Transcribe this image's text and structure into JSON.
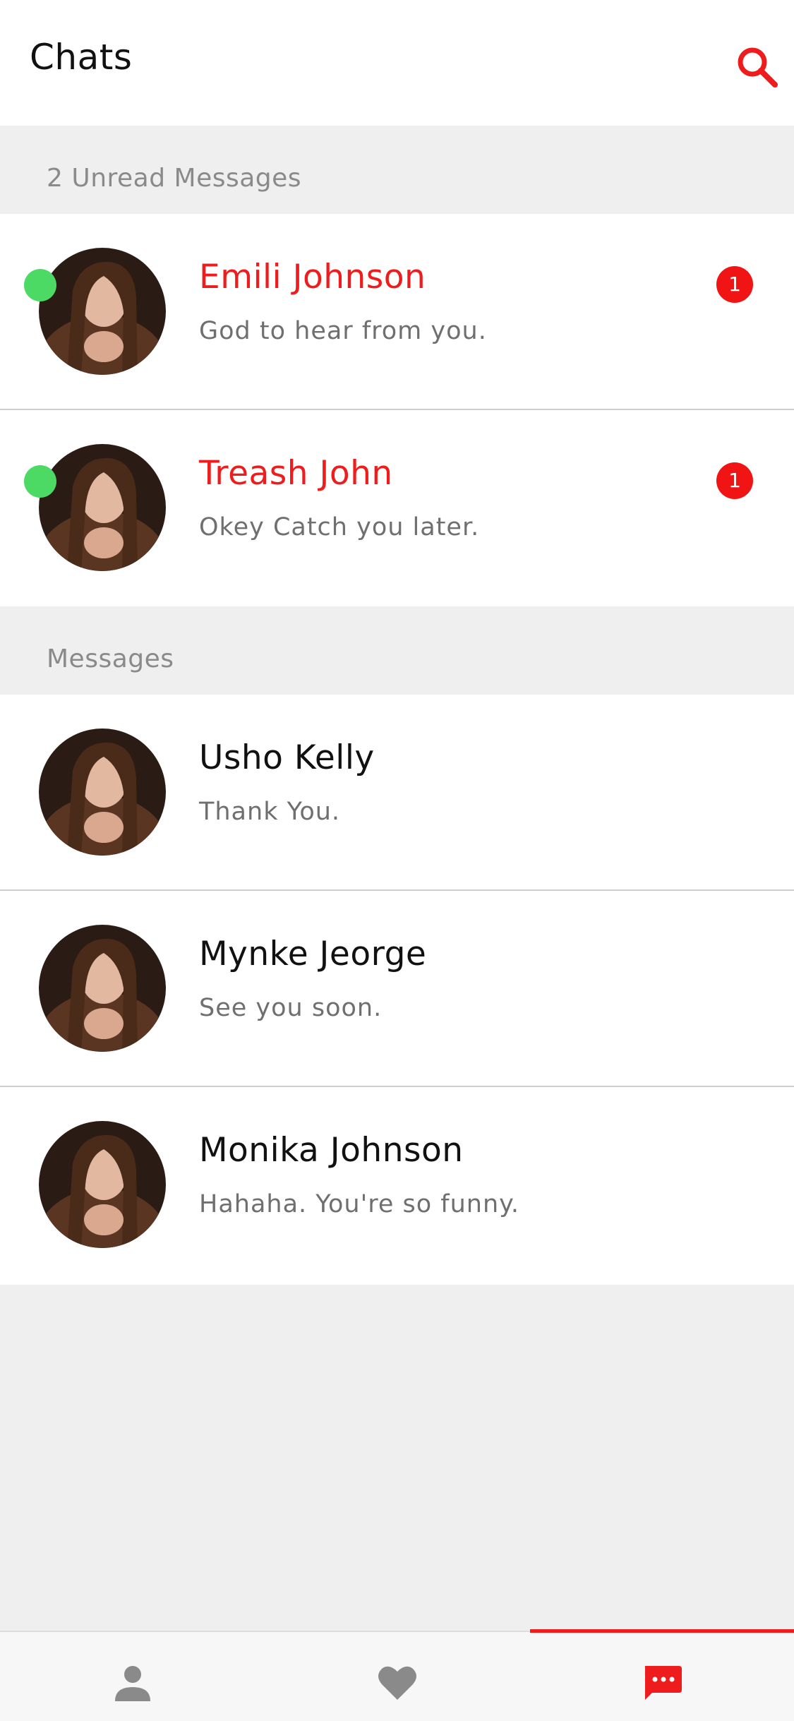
{
  "header": {
    "title": "Chats",
    "search_icon": "search-icon"
  },
  "sections": {
    "unread_label": "2 Unread Messages",
    "read_label": "Messages"
  },
  "chats": [
    {
      "name": "Emili Johnson",
      "preview": "God to hear from you.",
      "unread": true,
      "online": true,
      "badge": "1"
    },
    {
      "name": "Treash John",
      "preview": "Okey Catch you later.",
      "unread": true,
      "online": true,
      "badge": "1"
    },
    {
      "name": "Usho Kelly",
      "preview": "Thank You.",
      "unread": false,
      "online": false
    },
    {
      "name": "Mynke Jeorge",
      "preview": "See you soon.",
      "unread": false,
      "online": false
    },
    {
      "name": "Monika Johnson",
      "preview": "Hahaha. You're so funny.",
      "unread": false,
      "online": false
    }
  ],
  "bottom_nav": {
    "tabs": [
      {
        "icon": "person-icon",
        "active": false
      },
      {
        "icon": "heart-icon",
        "active": false
      },
      {
        "icon": "chat-bubble-icon",
        "active": true
      }
    ]
  },
  "colors": {
    "accent": "#ee1c1c",
    "online": "#4cd964",
    "background": "#efefef",
    "inactive_icon": "#8a8a8a"
  }
}
